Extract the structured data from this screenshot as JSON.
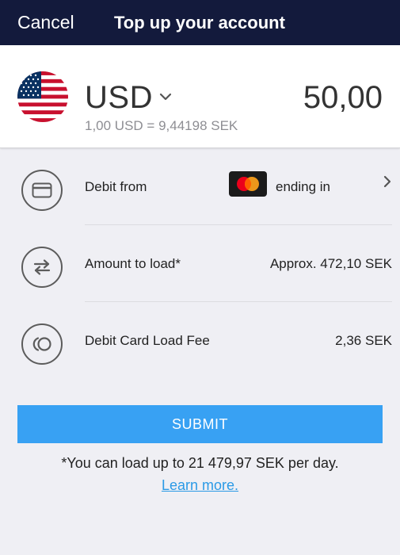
{
  "nav": {
    "cancel_label": "Cancel",
    "title": "Top up your account"
  },
  "amount_panel": {
    "currency_code": "USD",
    "amount": "50,00",
    "exchange_rate": "1,00 USD = 9,44198 SEK",
    "flag_icon": "us-flag-icon"
  },
  "rows": {
    "debit_from": {
      "label": "Debit from",
      "card_brand": "mastercard-logo",
      "card_text": "ending in",
      "icon": "credit-card-icon"
    },
    "amount_to_load": {
      "label": "Amount to load*",
      "value": "Approx. 472,10 SEK",
      "icon": "swap-arrows-icon"
    },
    "fee": {
      "label": "Debit Card Load Fee",
      "value": "2,36 SEK",
      "icon": "coins-icon"
    }
  },
  "actions": {
    "submit_label": "SUBMIT"
  },
  "footer": {
    "limit_note": "*You can load up to 21 479,97 SEK per day.",
    "learn_more": "Learn more."
  },
  "colors": {
    "nav_bg": "#131a3c",
    "submit_bg": "#38a1f3",
    "link": "#2b9ae6",
    "page_bg": "#efeff4"
  }
}
